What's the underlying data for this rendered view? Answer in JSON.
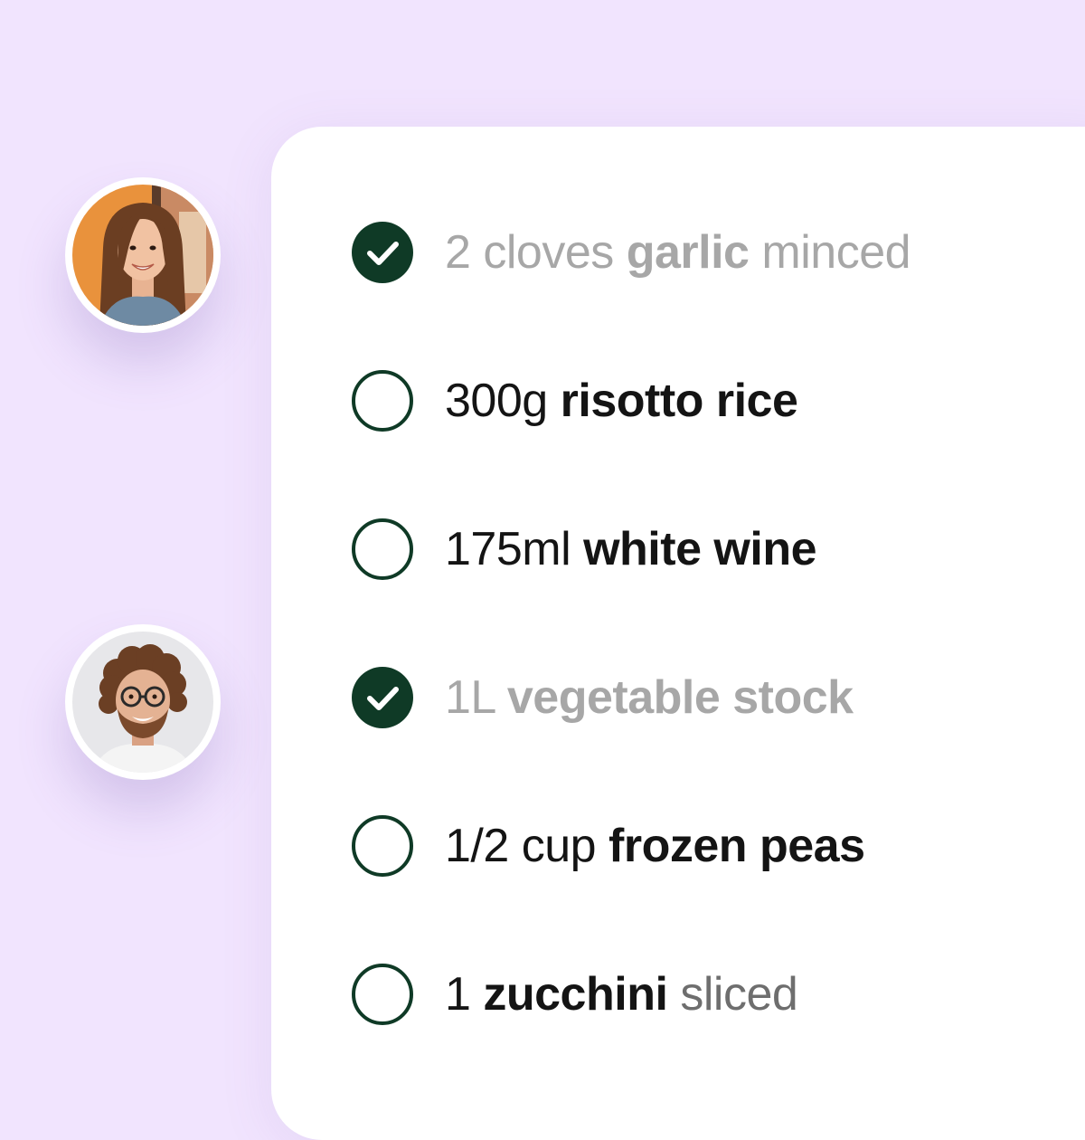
{
  "colors": {
    "background": "#f1e4fe",
    "card": "#ffffff",
    "check_fill": "#0f3a26",
    "text_active": "#141414",
    "text_done": "#a7a7a7",
    "text_note": "#6e6e6e"
  },
  "avatars": [
    {
      "icon": "avatar-woman"
    },
    {
      "icon": "avatar-man"
    }
  ],
  "ingredients": [
    {
      "quantity": "2 cloves",
      "name": "garlic",
      "note": "minced",
      "checked": true
    },
    {
      "quantity": "300g",
      "name": "risotto rice",
      "note": "",
      "checked": false
    },
    {
      "quantity": "175ml",
      "name": "white wine",
      "note": "",
      "checked": false
    },
    {
      "quantity": "1L",
      "name": "vegetable stock",
      "note": "",
      "checked": true
    },
    {
      "quantity": "1/2 cup",
      "name": "frozen peas",
      "note": "",
      "checked": false
    },
    {
      "quantity": "1",
      "name": "zucchini",
      "note": "sliced",
      "checked": false
    }
  ]
}
